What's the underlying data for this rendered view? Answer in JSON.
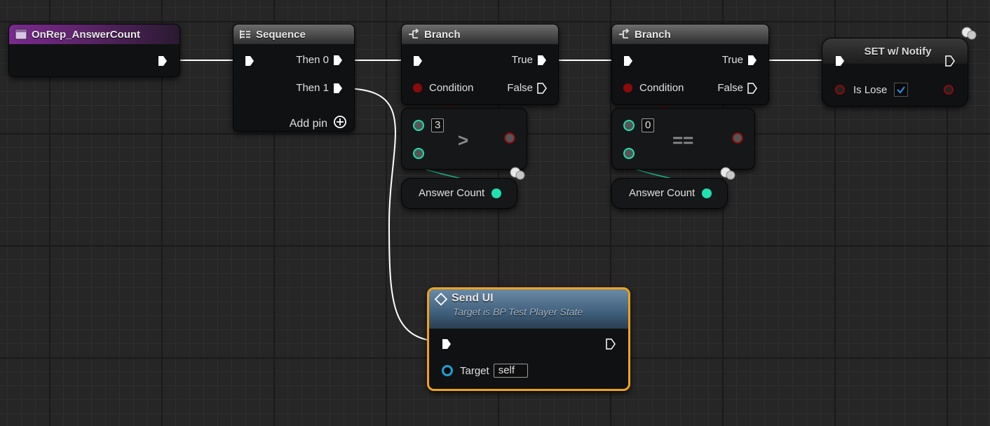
{
  "event_node": {
    "title": "OnRep_AnswerCount"
  },
  "sequence_node": {
    "title": "Sequence",
    "then0": "Then 0",
    "then1": "Then 1",
    "add_pin": "Add pin"
  },
  "branch1": {
    "title": "Branch",
    "true_label": "True",
    "false_label": "False",
    "condition": "Condition"
  },
  "branch2": {
    "title": "Branch",
    "true_label": "True",
    "false_label": "False",
    "condition": "Condition"
  },
  "compare_gt": {
    "operator": ">",
    "value": "3"
  },
  "compare_eq": {
    "operator": "==",
    "value": "0"
  },
  "getter1": {
    "label": "Answer Count"
  },
  "getter2": {
    "label": "Answer Count"
  },
  "set_node": {
    "title": "SET w/ Notify",
    "var_label": "Is Lose",
    "checked": true
  },
  "sendui_node": {
    "title": "Send UI",
    "subtitle": "Target is BP Test Player State",
    "target_label": "Target",
    "target_value": "self"
  },
  "colors": {
    "exec": "#ffffff",
    "bool": "#8c0a0a",
    "int": "#1fe0b0",
    "object": "#1aa1d6",
    "selection": "#f0a21a",
    "event_header": "#7a2a8e"
  }
}
